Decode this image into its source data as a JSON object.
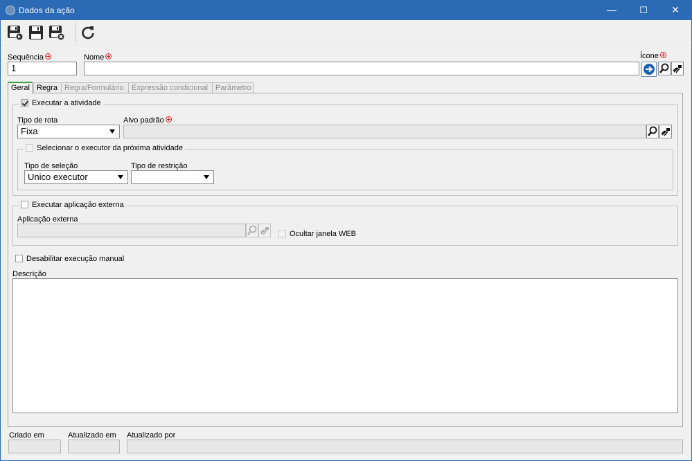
{
  "window": {
    "title": "Dados da ação",
    "minimize": "—",
    "maximize": "☐",
    "close": "✕"
  },
  "toolbar": {
    "items": [
      "save-new-icon",
      "save-icon",
      "save-close-icon",
      "refresh-icon"
    ]
  },
  "header": {
    "sequence_label": "Sequência",
    "sequence_value": "1",
    "name_label": "Nome",
    "name_value": "",
    "icon_label": "Ícone"
  },
  "tabs": [
    {
      "label": "Geral",
      "active": true,
      "enabled": true
    },
    {
      "label": "Regra",
      "active": false,
      "enabled": true
    },
    {
      "label": "Regra/Formulário",
      "active": false,
      "enabled": false
    },
    {
      "label": "Expressão condicional",
      "active": false,
      "enabled": false
    },
    {
      "label": "Parâmetro",
      "active": false,
      "enabled": false
    }
  ],
  "execute_activity": {
    "label": "Executar a atividade",
    "checked": true,
    "route_type_label": "Tipo de rota",
    "route_type_value": "Fixa",
    "default_target_label": "Alvo padrão",
    "default_target_value": "",
    "select_executor": {
      "label": "Selecionar o executor da próxima atividade",
      "checked": false,
      "selection_type_label": "Tipo de seleção",
      "selection_type_value": "Unico executor",
      "restriction_type_label": "Tipo de restrição",
      "restriction_type_value": ""
    }
  },
  "external_app": {
    "label": "Executar aplicação externa",
    "checked": false,
    "app_label": "Aplicação externa",
    "app_value": "",
    "hide_web_label": "Ocultar janela WEB"
  },
  "disable_manual": {
    "label": "Desabilitar execução manual",
    "checked": false
  },
  "description": {
    "label": "Descrição",
    "value": ""
  },
  "footer": {
    "created_label": "Criado em",
    "created_value": "",
    "updated_label": "Atualizado em",
    "updated_value": "",
    "updated_by_label": "Atualizado por",
    "updated_by_value": ""
  },
  "colors": {
    "titlebar": "#2b6ab5",
    "required": "#e02020",
    "active_tab": "#3aa03a",
    "icon_button": "#1c5fb0"
  }
}
